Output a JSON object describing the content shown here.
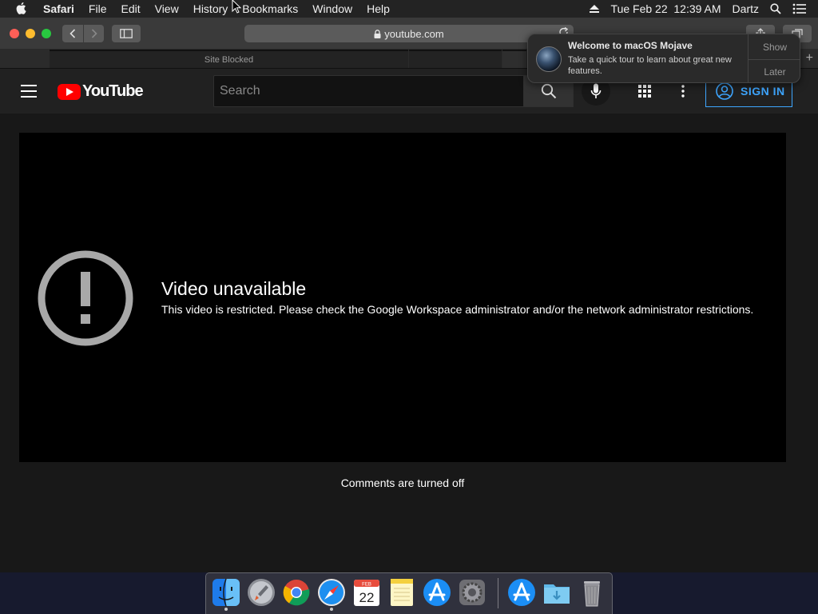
{
  "menubar": {
    "app_name": "Safari",
    "items": [
      "File",
      "Edit",
      "View",
      "History",
      "Bookmarks",
      "Window",
      "Help"
    ],
    "clock": "Tue Feb 22  12:39 AM",
    "user": "Dartz"
  },
  "browser": {
    "url": "youtube.com",
    "tabs": [
      {
        "title": "Site Blocked"
      },
      {
        "title": ""
      },
      {
        "title": ""
      }
    ]
  },
  "youtube": {
    "logo_text": "YouTube",
    "search_placeholder": "Search",
    "sign_in_label": "SIGN IN",
    "player": {
      "error_title": "Video unavailable",
      "error_message": "This video is restricted. Please check the Google Workspace administrator and/or the network administrator restrictions."
    },
    "comments_notice": "Comments are turned off"
  },
  "notification": {
    "title": "Welcome to macOS Mojave",
    "body": "Take a quick tour to learn about great new features.",
    "show_label": "Show",
    "later_label": "Later"
  },
  "dock": {
    "apps": [
      "finder-icon",
      "launchpad-icon",
      "chrome-icon",
      "safari-icon",
      "calendar-icon",
      "notes-icon",
      "app-store-icon",
      "system-preferences-icon",
      "app-store-icon",
      "downloads-folder-icon",
      "trash-icon"
    ],
    "calendar_month": "FEB",
    "calendar_day": "22"
  },
  "colors": {
    "youtube_red": "#ff0000",
    "sign_in_blue": "#3ea6ff",
    "player_bg": "#000000",
    "page_bg": "#181818"
  }
}
